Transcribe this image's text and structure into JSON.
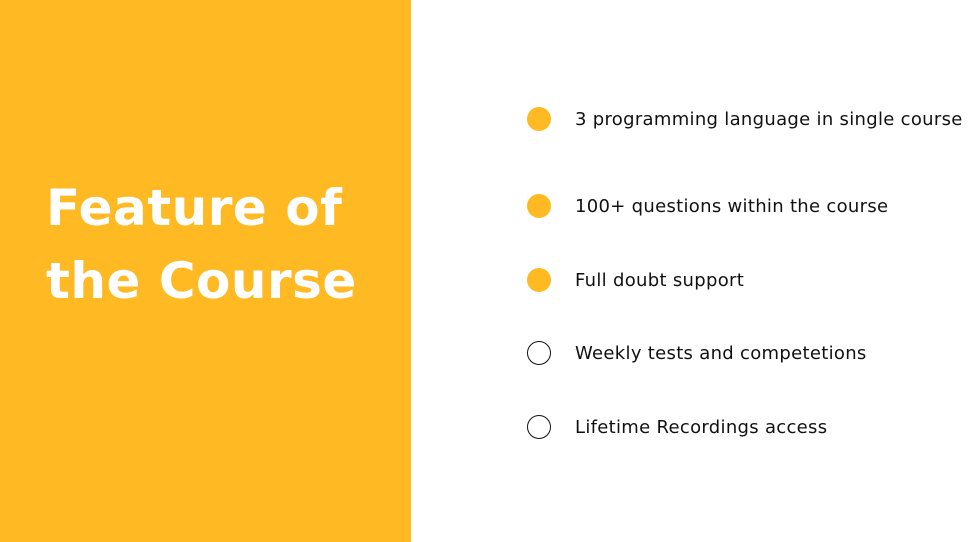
{
  "colors": {
    "accent": "#FFB923",
    "panel_text": "#FFFFFF",
    "body_text": "#111111",
    "background": "#FFFFFF"
  },
  "title": {
    "line1": "Feature of",
    "line2": "the Course"
  },
  "features": [
    {
      "text": "3 programming language in single course",
      "bullet": "filled-circle"
    },
    {
      "text": "100+ questions within the course",
      "bullet": "filled-circle"
    },
    {
      "text": "Full doubt support",
      "bullet": "filled-circle"
    },
    {
      "text": "Weekly tests and competetions",
      "bullet": "hollow-circle"
    },
    {
      "text": "Lifetime Recordings access",
      "bullet": "hollow-circle"
    }
  ]
}
